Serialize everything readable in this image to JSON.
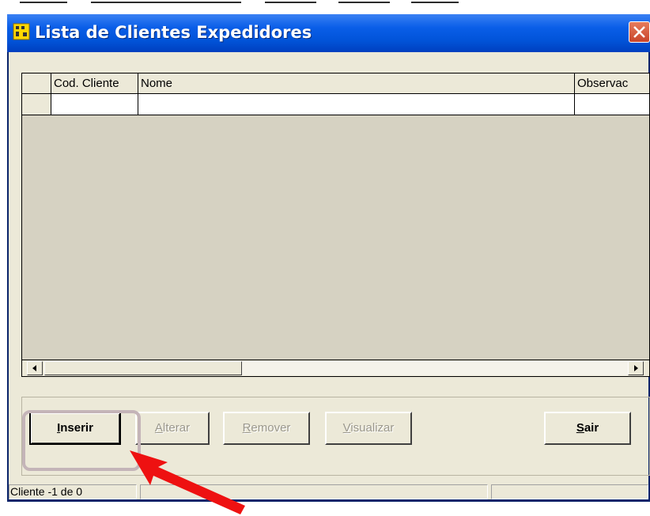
{
  "window": {
    "title": "Lista de Clientes Expedidores",
    "app_icon": "yellow-app-icon",
    "close_icon": "close-icon",
    "titlebar_color": "#0153d8"
  },
  "grid": {
    "columns": [
      "Cod. Cliente",
      "Nome",
      "Observac"
    ],
    "rows": [
      [
        "",
        "",
        ""
      ]
    ],
    "scroll_left_icon": "scroll-left-arrow-icon",
    "scroll_right_icon": "scroll-right-arrow-icon"
  },
  "buttons": {
    "inserir": {
      "underline": "I",
      "rest": "nserir",
      "enabled": true
    },
    "alterar": {
      "underline": "A",
      "rest": "lterar",
      "enabled": false
    },
    "remover": {
      "underline": "R",
      "rest": "emover",
      "enabled": false
    },
    "visualizar": {
      "underline": "V",
      "rest": "isualizar",
      "enabled": false
    },
    "sair": {
      "underline": "S",
      "rest": "air",
      "enabled": true
    }
  },
  "status": {
    "text": "Cliente -1 de 0",
    "panel2": "",
    "panel3": ""
  },
  "annotation": {
    "highlight_color": "#c4b4b8",
    "arrow_color": "#ee1111"
  }
}
